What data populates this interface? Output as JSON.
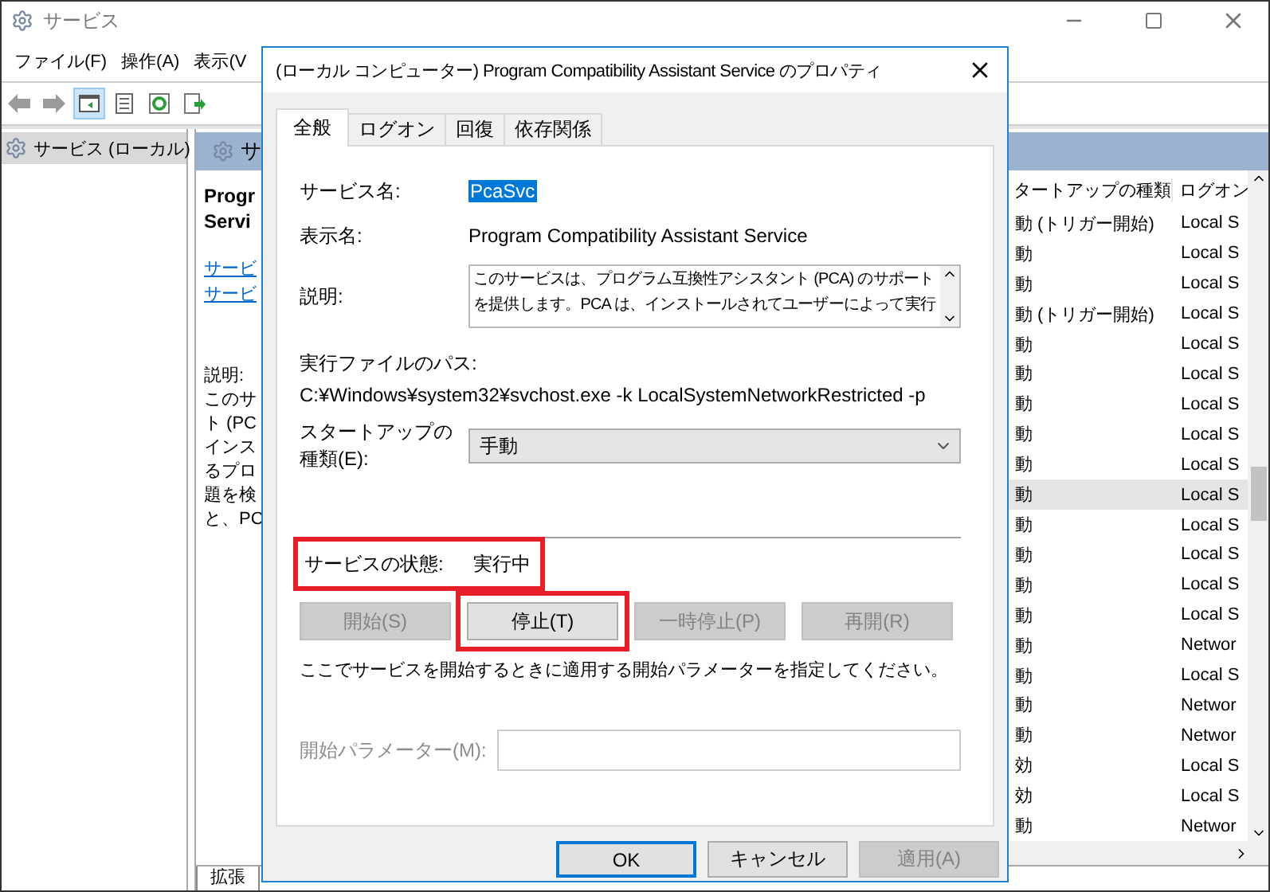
{
  "main_window": {
    "title": "サービス",
    "menu": [
      "ファイル(F)",
      "操作(A)",
      "表示(V"
    ]
  },
  "tree": {
    "items": [
      {
        "label": "サービス (ローカル)",
        "selected": true
      }
    ]
  },
  "detail": {
    "header": "サ",
    "title_lines": [
      "Progr",
      "Servi"
    ],
    "links": [
      "サービ",
      "サービ"
    ],
    "description_lines": [
      "説明:",
      "このサ",
      "ト (PC",
      "インス",
      "るプロ",
      "題を検",
      "と、PC"
    ]
  },
  "table": {
    "columns": [
      "タートアップの種類",
      "ログオン"
    ],
    "rows": [
      {
        "startup": "動 (トリガー開始)",
        "logon": "Local S",
        "selected": false
      },
      {
        "startup": "動",
        "logon": "Local S",
        "selected": false
      },
      {
        "startup": "動",
        "logon": "Local S",
        "selected": false
      },
      {
        "startup": "動 (トリガー開始)",
        "logon": "Local S",
        "selected": false
      },
      {
        "startup": "動",
        "logon": "Local S",
        "selected": false
      },
      {
        "startup": "動",
        "logon": "Local S",
        "selected": false
      },
      {
        "startup": "動",
        "logon": "Local S",
        "selected": false
      },
      {
        "startup": "動",
        "logon": "Local S",
        "selected": false
      },
      {
        "startup": "動",
        "logon": "Local S",
        "selected": false
      },
      {
        "startup": "動",
        "logon": "Local S",
        "selected": true
      },
      {
        "startup": "動",
        "logon": "Local S",
        "selected": false
      },
      {
        "startup": "動",
        "logon": "Local S",
        "selected": false
      },
      {
        "startup": "動",
        "logon": "Local S",
        "selected": false
      },
      {
        "startup": "動",
        "logon": "Local S",
        "selected": false
      },
      {
        "startup": "動",
        "logon": "Networ",
        "selected": false
      },
      {
        "startup": "動",
        "logon": "Local S",
        "selected": false
      },
      {
        "startup": "動",
        "logon": "Networ",
        "selected": false
      },
      {
        "startup": "動",
        "logon": "Networ",
        "selected": false
      },
      {
        "startup": "効",
        "logon": "Local S",
        "selected": false
      },
      {
        "startup": "効",
        "logon": "Local S",
        "selected": false
      },
      {
        "startup": "動",
        "logon": "Networ",
        "selected": false
      }
    ]
  },
  "bottom_tabs": [
    "拡張"
  ],
  "dialog": {
    "title": "(ローカル コンピューター) Program Compatibility Assistant Service のプロパティ",
    "tabs": [
      {
        "label": "全般",
        "selected": true
      },
      {
        "label": "ログオン",
        "selected": false
      },
      {
        "label": "回復",
        "selected": false
      },
      {
        "label": "依存関係",
        "selected": false
      }
    ],
    "service_name": {
      "label": "サービス名:",
      "value": "PcaSvc"
    },
    "display_name": {
      "label": "表示名:",
      "value": "Program Compatibility Assistant Service"
    },
    "description": {
      "label": "説明:",
      "lines": [
        "このサービスは、プログラム互換性アシスタント (PCA) のサポート",
        "を提供します。PCA は、インストールされてユーザーによって実行"
      ]
    },
    "path": {
      "label": "実行ファイルのパス:",
      "value": "C:¥Windows¥system32¥svchost.exe -k LocalSystemNetworkRestricted -p"
    },
    "startup_type": {
      "label_lines": [
        "スタートアップの",
        "種類(E):"
      ],
      "value": "手動"
    },
    "status": {
      "label": "サービスの状態:",
      "value": "実行中",
      "highlighted": true
    },
    "service_buttons": [
      {
        "label": "開始(S)",
        "disabled": true,
        "highlighted": false
      },
      {
        "label": "停止(T)",
        "disabled": false,
        "highlighted": true
      },
      {
        "label": "一時停止(P)",
        "disabled": true,
        "highlighted": false
      },
      {
        "label": "再開(R)",
        "disabled": true,
        "highlighted": false
      }
    ],
    "hint": "ここでサービスを開始するときに適用する開始パラメーターを指定してください。",
    "start_parameters": {
      "label": "開始パラメーター(M):",
      "disabled": true
    },
    "buttons": [
      {
        "label": "OK",
        "default": true,
        "disabled": false
      },
      {
        "label": "キャンセル",
        "default": false,
        "disabled": false
      },
      {
        "label": "適用(A)",
        "default": false,
        "disabled": true
      }
    ]
  }
}
